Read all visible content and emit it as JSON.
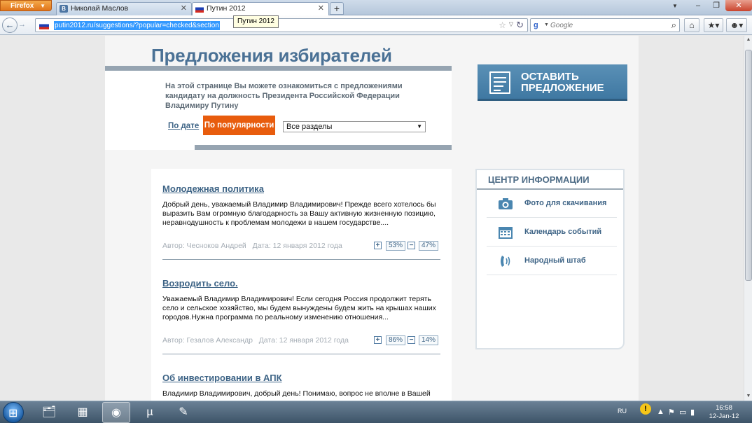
{
  "browser": {
    "app_button": "Firefox",
    "tabs": [
      {
        "label": "Николай Маслов",
        "favicon": "vk-icon"
      },
      {
        "label": "Путин 2012",
        "favicon": "russia-flag-icon"
      }
    ],
    "tooltip": "Путин 2012",
    "url": "putin2012.ru/suggestions/?popular=checked&section",
    "search_placeholder": "Google"
  },
  "page": {
    "title": "Предложения избирателей",
    "intro": "На этой странице Вы можете ознакомиться с предложениями кандидату на должность Президента Российской Федерации Владимиру Путину",
    "sort_by_date": "По дате",
    "sort_by_popularity": "По популярности",
    "section_select": "Все разделы",
    "cta": {
      "line1": "ОСТАВИТЬ",
      "line2": "ПРЕДЛОЖЕНИЕ"
    },
    "suggestions": [
      {
        "title": "Молодежная политика",
        "excerpt": "Добрый день, уважаемый Владимир Владимирович! Прежде всего хотелось бы выразить Вам огромную благодарность за Вашу активную жизненную позицию, неравнодушность к проблемам молодежи в нашем государстве....",
        "author": "Автор: Чесноков Андрей",
        "date": "Дата: 12 января 2012 года",
        "up": "53%",
        "down": "47%"
      },
      {
        "title": "Возродить село.",
        "excerpt": "Уважаемый Владимир Владимирович! Если сегодня Россия продолжит терять село и сельское хозяйство, мы будем вынуждены будем жить на крышах наших городов.Нужна программа по реальному изменению отношения...",
        "author": "Автор: Гезалов Александр",
        "date": "Дата: 12 января 2012 года",
        "up": "86%",
        "down": "14%"
      },
      {
        "title": "Об инвестировании в АПК",
        "excerpt": "Владимир Владимирович, добрый день! Понимаю, вопрос не вполне в Вашей"
      }
    ],
    "info_center": {
      "title": "ЦЕНТР ИНФОРМАЦИИ",
      "items": [
        {
          "label": "Фото для скачивания",
          "icon": "camera-icon"
        },
        {
          "label": "Календарь событий",
          "icon": "calendar-icon"
        },
        {
          "label": "Народный штаб",
          "icon": "phone-icon"
        }
      ]
    }
  },
  "taskbar": {
    "language": "RU",
    "time": "16:58",
    "date": "12-Jan-12"
  },
  "colors": {
    "accent": "#4a7195",
    "orange": "#e85c0d",
    "cta": "#4a86b0"
  }
}
